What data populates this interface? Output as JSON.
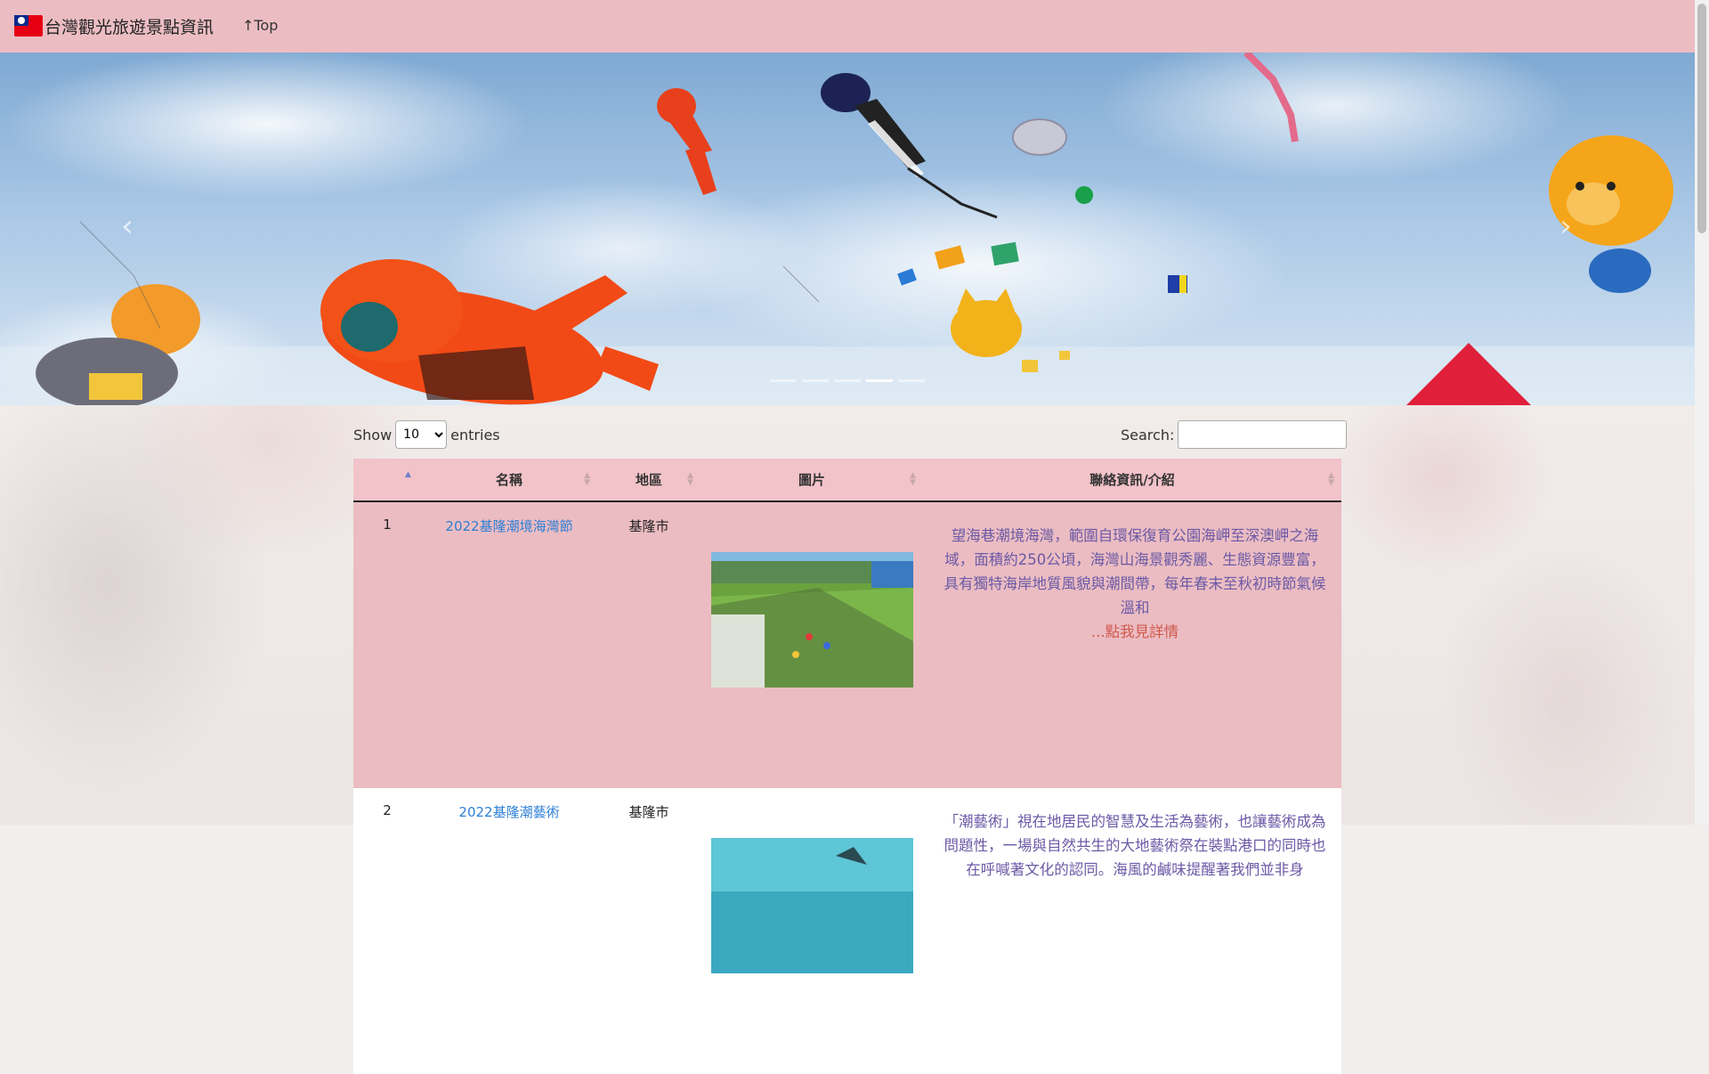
{
  "navbar": {
    "brand": "台灣觀光旅遊景點資訊",
    "top_link": "↑Top"
  },
  "carousel": {
    "slide_count": 5,
    "active_index": 3,
    "prev_icon": "chevron-left",
    "next_icon": "chevron-right"
  },
  "datatable": {
    "show_label": "Show",
    "length_value": "10",
    "entries_label": "entries",
    "search_label": "Search:",
    "search_value": ""
  },
  "table": {
    "headers": [
      "",
      "名稱",
      "地區",
      "圖片",
      "聯絡資訊/介紹"
    ],
    "rows": [
      {
        "no": "1",
        "name": "2022基隆潮境海灣節",
        "area": "基隆市",
        "intro": "望海巷潮境海灣，範圍自環保復育公園海岬至深澳岬之海域，面積約250公頃，海灣山海景觀秀麗、生態資源豐富，具有獨特海岸地質風貌與潮間帶，每年春末至秋初時節氣候溫和",
        "more": "...點我見詳情"
      },
      {
        "no": "2",
        "name": "2022基隆潮藝術",
        "area": "基隆市",
        "intro": "「潮藝術」視在地居民的智慧及生活為藝術，也讓藝術成為問題性，一場與自然共生的大地藝術祭在裝點港口的同時也在呼喊著文化的認同。海風的鹹味提醒著我們並非身",
        "more": ""
      }
    ]
  },
  "colors": {
    "navbar": "#ebbdc3",
    "header": "#f2c3c9",
    "row_odd": "#ebbcc2",
    "link": "#2e7fd6",
    "intro_text": "#6b5aa6",
    "more_link": "#d05a4d"
  }
}
